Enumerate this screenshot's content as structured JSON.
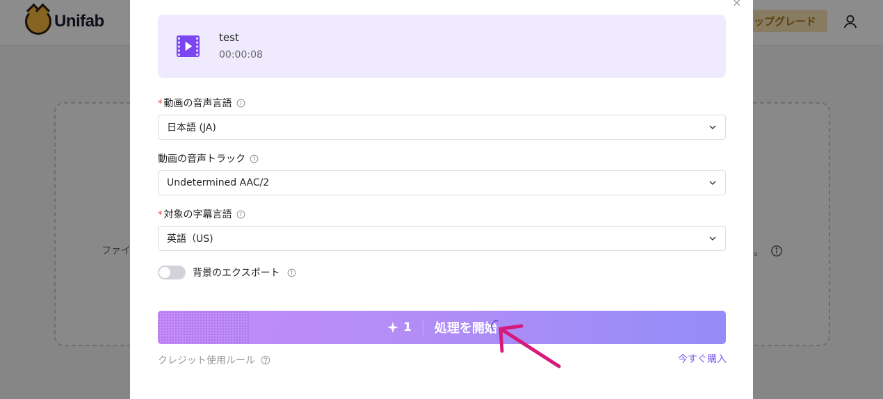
{
  "app": {
    "brand_name": "Unifab",
    "upgrade_label": "ップグレード",
    "upload_hint_left": "ファイ",
    "upload_hint_right": "。"
  },
  "modal": {
    "file": {
      "name": "test",
      "duration": "00:00:08"
    },
    "fields": [
      {
        "label": "動画の音声言語",
        "required": true,
        "value": "日本語 (JA)"
      },
      {
        "label": "動画の音声トラック",
        "required": false,
        "value": "Undetermined AAC/2"
      },
      {
        "label": "対象の字幕言語",
        "required": true,
        "value": "英語（US)"
      }
    ],
    "required_mark": "*",
    "export_background_label": "背景のエクスポート",
    "export_background_on": false,
    "start_button": {
      "credits": "1",
      "label": "処理を開始"
    },
    "credit_rules_label": "クレジット使用ルール",
    "buy_now_label": "今すぐ購入",
    "close_symbol": "×"
  },
  "colors": {
    "accent": "#7b5cf0",
    "file_card_bg": "#efeafe",
    "required": "#e0453a",
    "annotation_arrow": "#d6197a",
    "button_gradient_start": "#c58cf7",
    "button_gradient_end": "#948cf8"
  },
  "icons": {
    "video": "video-file-icon",
    "info": "info-circle-icon",
    "chevron": "chevron-down-icon",
    "sparkle": "sparkle-icon",
    "spinner": "loading-spinner-icon",
    "help": "help-circle-icon",
    "user": "user-icon",
    "close": "close-icon"
  }
}
